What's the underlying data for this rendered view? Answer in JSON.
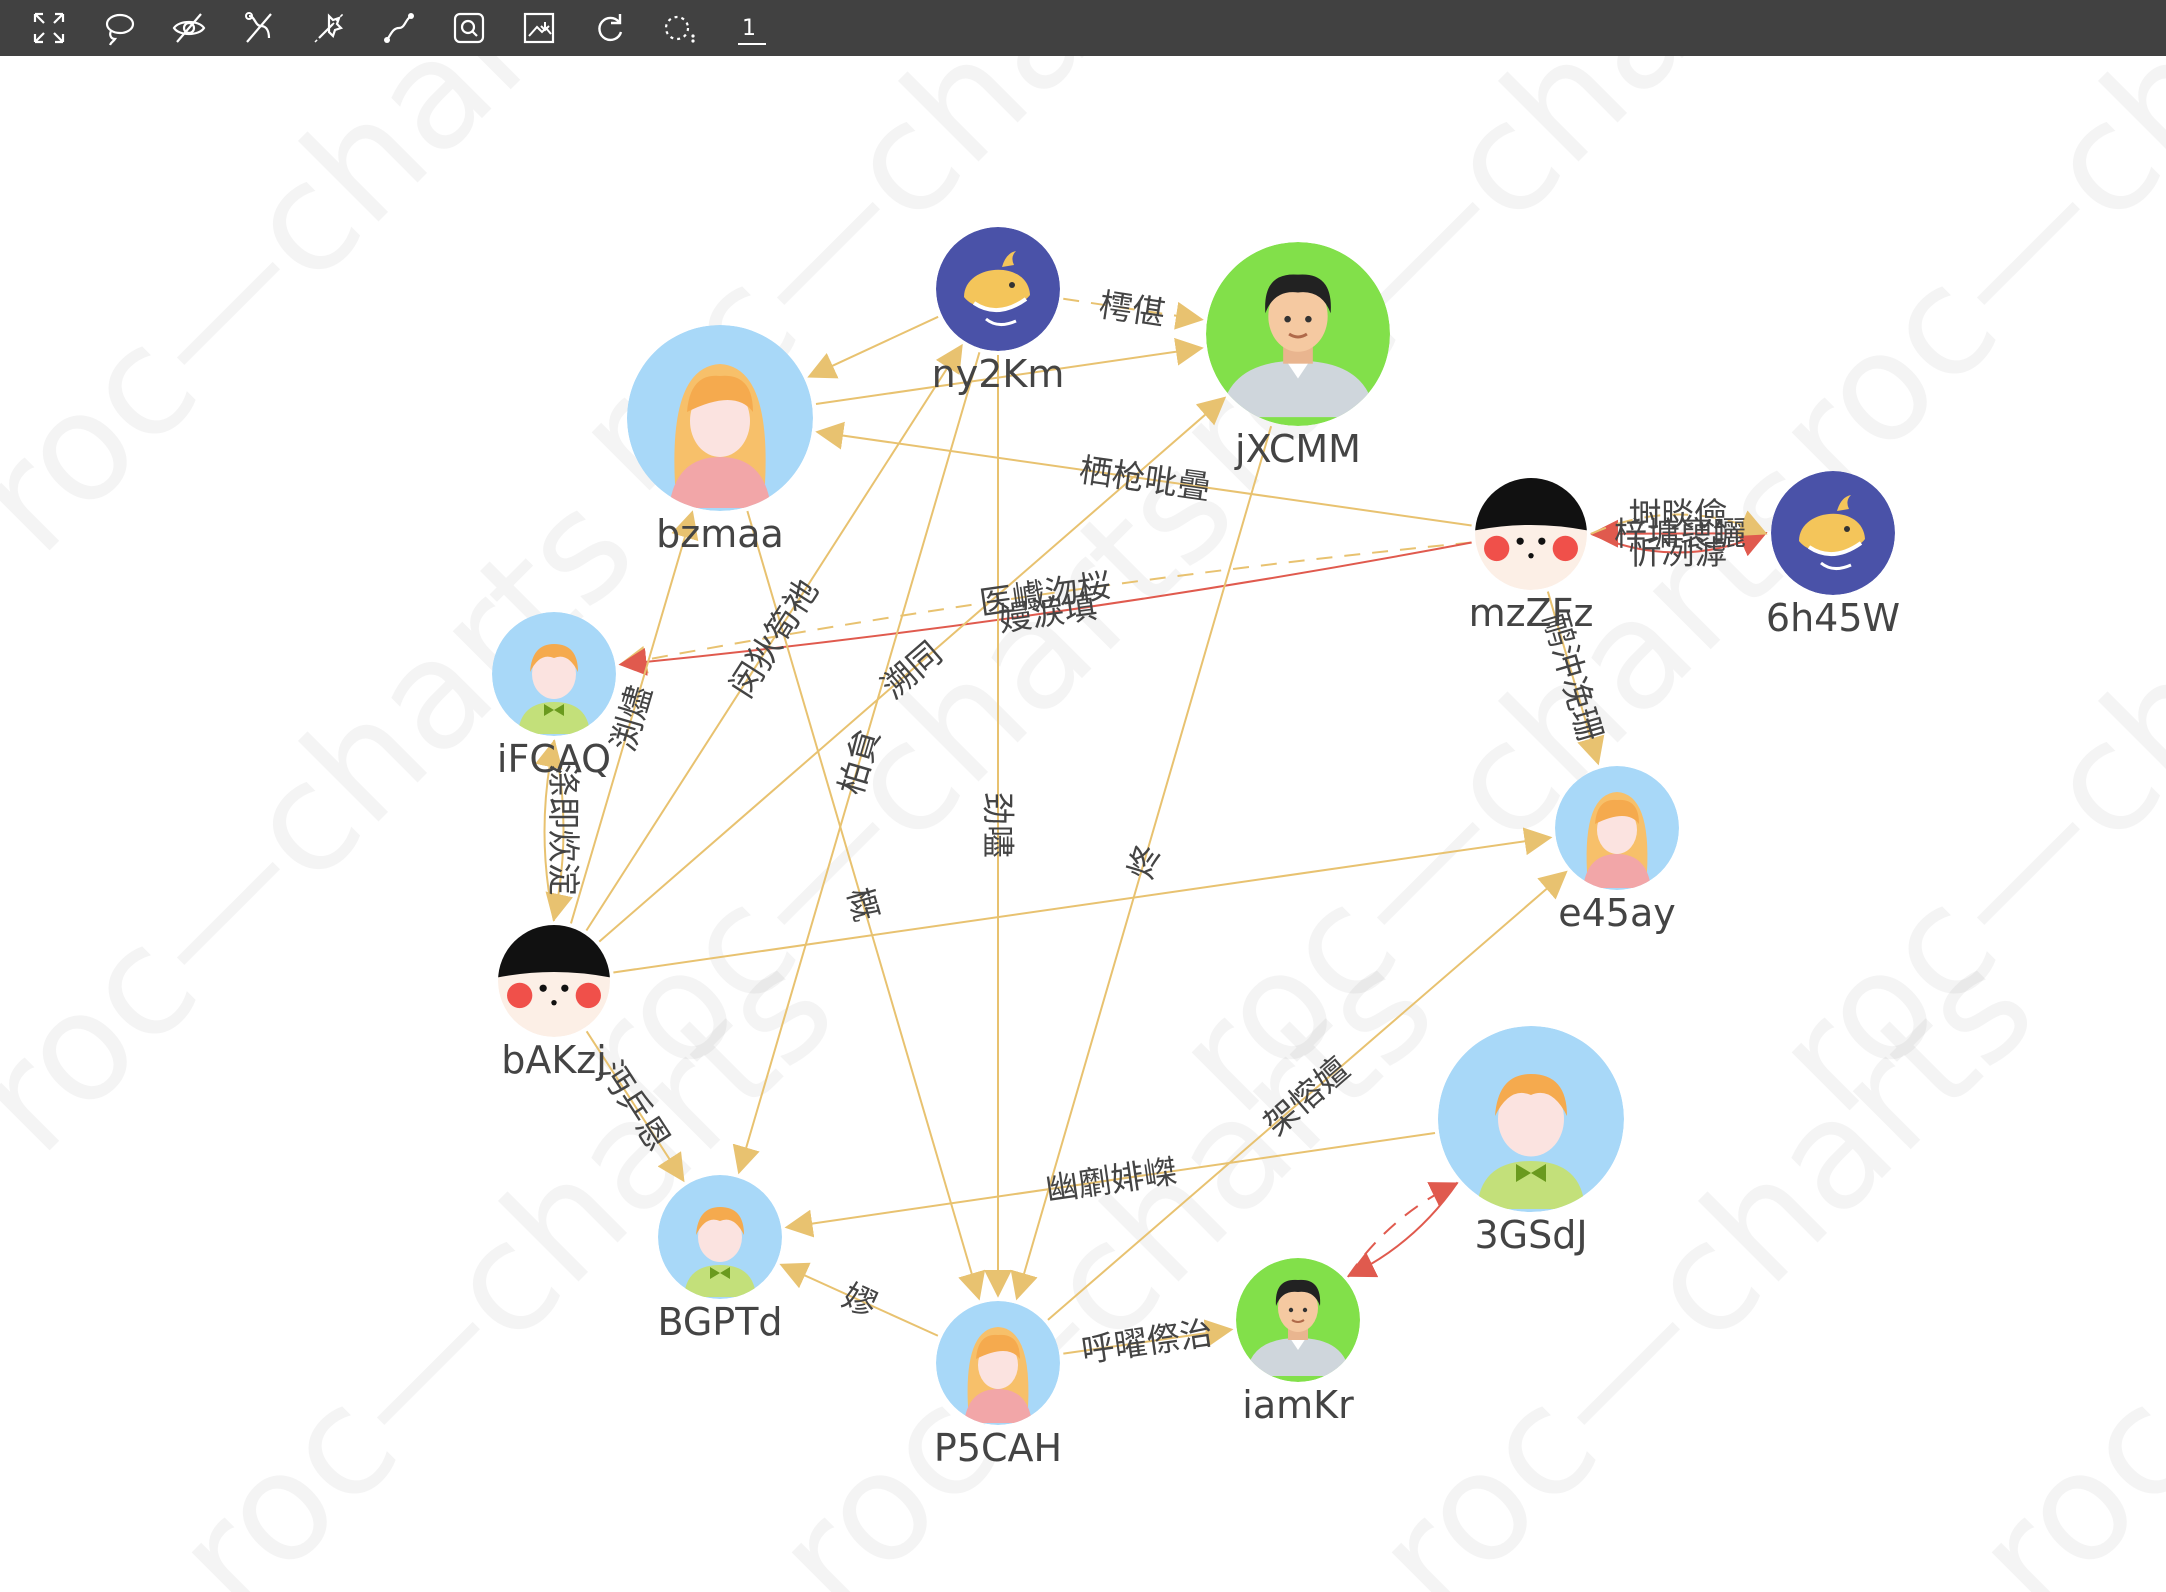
{
  "toolbar": {
    "tools": [
      {
        "name": "fit-view-icon"
      },
      {
        "name": "lasso-select-icon"
      },
      {
        "name": "hide-icon"
      },
      {
        "name": "edit-link-icon"
      },
      {
        "name": "settings-icon"
      },
      {
        "name": "path-icon"
      },
      {
        "name": "search-icon"
      },
      {
        "name": "export-image-icon"
      },
      {
        "name": "refresh-icon"
      },
      {
        "name": "layout-icon"
      }
    ],
    "page_indicator": "1"
  },
  "watermark": "roc—charts",
  "colors": {
    "edge": "#e8c270",
    "edge_highlight": "#e05a4e",
    "label": "#444444",
    "toolbar": "#414141",
    "avatar_green": "#82e04a",
    "avatar_blue": "#a8d8f8",
    "avatar_navy": "#4a52a8"
  },
  "nodes": [
    {
      "id": "ny2Km",
      "label": "ny2Km",
      "avatar": "whale"
    },
    {
      "id": "jXCMM",
      "label": "jXCMM",
      "avatar": "man"
    },
    {
      "id": "bzmaa",
      "label": "bzmaa",
      "avatar": "girl"
    },
    {
      "id": "mzZFz",
      "label": "mzZFz",
      "avatar": "kid"
    },
    {
      "id": "6h45W",
      "label": "6h45W",
      "avatar": "whale"
    },
    {
      "id": "iFCAQ",
      "label": "iFCAQ",
      "avatar": "boy"
    },
    {
      "id": "e45ay",
      "label": "e45ay",
      "avatar": "girl"
    },
    {
      "id": "bAKzj",
      "label": "bAKzj",
      "avatar": "kid"
    },
    {
      "id": "3GSdJ",
      "label": "3GSdJ",
      "avatar": "boy"
    },
    {
      "id": "BGPTd",
      "label": "BGPTd",
      "avatar": "boy"
    },
    {
      "id": "iamKr",
      "label": "iamKr",
      "avatar": "man"
    },
    {
      "id": "P5CAH",
      "label": "P5CAH",
      "avatar": "girl"
    }
  ],
  "edges": [
    {
      "source": "ny2Km",
      "target": "jXCMM",
      "label": "樗偡",
      "style": "dashed"
    },
    {
      "source": "ny2Km",
      "target": "bzmaa",
      "label": "",
      "style": "solid"
    },
    {
      "source": "bzmaa",
      "target": "jXCMM",
      "label": "",
      "style": "solid"
    },
    {
      "source": "mzZFz",
      "target": "bzmaa",
      "label": "栖枪吡曡",
      "style": "solid"
    },
    {
      "source": "mzZFz",
      "target": "6h45W",
      "label": "忻冽滹",
      "style": "solid",
      "color": "red"
    },
    {
      "source": "6h45W",
      "target": "mzZFz",
      "label": "梓墉褏矖",
      "style": "solid",
      "color": "red"
    },
    {
      "source": "mzZFz",
      "target": "6h45W",
      "label": "埘晱儉",
      "style": "dashed"
    },
    {
      "source": "mzZFz",
      "target": "iFCAQ",
      "label": "医巇沕桜",
      "style": "dashed"
    },
    {
      "source": "mzZFz",
      "target": "iFCAQ",
      "label": "嫚淚填",
      "style": "solid",
      "color": "red"
    },
    {
      "source": "mzZFz",
      "target": "e45ay",
      "label": "鸸沖凂珊",
      "style": "solid"
    },
    {
      "source": "bAKzj",
      "target": "iFCAQ",
      "label": "",
      "style": "solid"
    },
    {
      "source": "iFCAQ",
      "target": "bAKzj",
      "label": "涤即炊淀",
      "style": "solid"
    },
    {
      "source": "bAKzj",
      "target": "bzmaa",
      "label": "渕燼",
      "style": "solid"
    },
    {
      "source": "bAKzj",
      "target": "ny2Km",
      "label": "闵狄筍祂",
      "style": "solid"
    },
    {
      "source": "bAKzj",
      "target": "jXCMM",
      "label": "溯同",
      "style": "solid"
    },
    {
      "source": "bAKzj",
      "target": "e45ay",
      "label": "",
      "style": "solid"
    },
    {
      "source": "bAKzj",
      "target": "BGPTd",
      "label": "沔乒恩",
      "style": "solid"
    },
    {
      "source": "ny2Km",
      "target": "BGPTd",
      "label": "柏貟",
      "style": "solid"
    },
    {
      "source": "ny2Km",
      "target": "P5CAH",
      "label": "劲嚍",
      "style": "solid"
    },
    {
      "source": "bzmaa",
      "target": "P5CAH",
      "label": "概",
      "style": "solid"
    },
    {
      "source": "jXCMM",
      "target": "P5CAH",
      "label": "炵",
      "style": "solid"
    },
    {
      "source": "3GSdJ",
      "target": "BGPTd",
      "label": "幽劘婔嵥",
      "style": "solid"
    },
    {
      "source": "P5CAH",
      "target": "e45ay",
      "label": "架愹嬗",
      "style": "solid"
    },
    {
      "source": "P5CAH",
      "target": "BGPTd",
      "label": "嫪",
      "style": "solid"
    },
    {
      "source": "P5CAH",
      "target": "iamKr",
      "label": "呼曜傺治",
      "style": "solid"
    },
    {
      "source": "3GSdJ",
      "target": "iamKr",
      "label": "",
      "style": "solid",
      "color": "red"
    },
    {
      "source": "iamKr",
      "target": "3GSdJ",
      "label": "",
      "style": "dashed",
      "color": "red"
    }
  ]
}
